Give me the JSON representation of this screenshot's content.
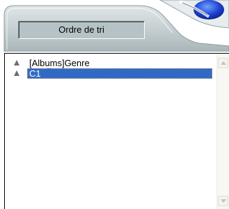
{
  "header": {
    "sort_label": "Ordre de tri"
  },
  "list": {
    "items": [
      {
        "label": "[Albums]Genre",
        "selected": false
      },
      {
        "label": "C1",
        "selected": true
      }
    ]
  },
  "colors": {
    "selection": "#316ac5",
    "skin_gray": "#b6c3c6",
    "triangle": "#6d6d6d"
  },
  "icons": {
    "sort_ascending": "triangle-up-icon",
    "scroll_up": "scroll-up-arrow-icon",
    "scroll_down": "scroll-down-arrow-icon",
    "decoration": "blue-orb-ornament"
  }
}
